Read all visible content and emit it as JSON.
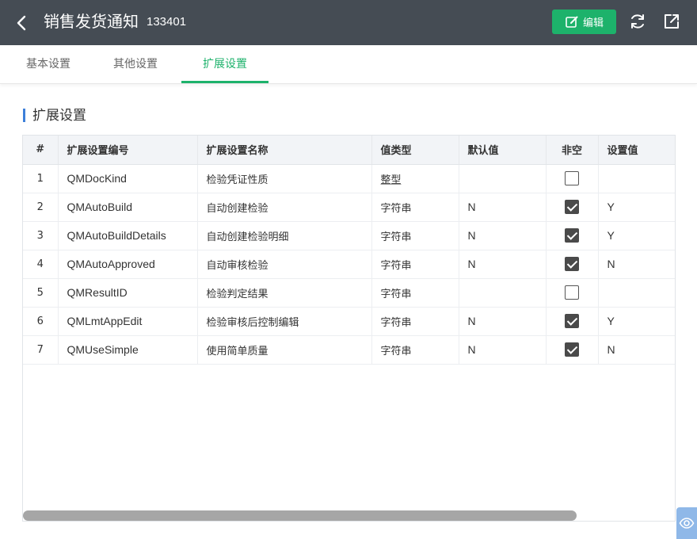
{
  "header": {
    "title": "销售发货通知",
    "doc_no": "133401",
    "edit_label": "编辑"
  },
  "tabs": [
    {
      "label": "基本设置",
      "active": false
    },
    {
      "label": "其他设置",
      "active": false
    },
    {
      "label": "扩展设置",
      "active": true
    }
  ],
  "section": {
    "title": "扩展设置"
  },
  "table": {
    "columns": [
      "#",
      "扩展设置编号",
      "扩展设置名称",
      "值类型",
      "默认值",
      "非空",
      "设置值"
    ],
    "rows": [
      {
        "num": "1",
        "code": "QMDocKind",
        "name": "检验凭证性质",
        "type": "整型",
        "default": "",
        "required": false,
        "value": ""
      },
      {
        "num": "2",
        "code": "QMAutoBuild",
        "name": "自动创建检验",
        "type": "字符串",
        "default": "N",
        "required": true,
        "value": "Y"
      },
      {
        "num": "3",
        "code": "QMAutoBuildDetails",
        "name": "自动创建检验明细",
        "type": "字符串",
        "default": "N",
        "required": true,
        "value": "Y"
      },
      {
        "num": "4",
        "code": "QMAutoApproved",
        "name": "自动审核检验",
        "type": "字符串",
        "default": "N",
        "required": true,
        "value": "N"
      },
      {
        "num": "5",
        "code": "QMResultID",
        "name": "检验判定结果",
        "type": "字符串",
        "default": "",
        "required": false,
        "value": ""
      },
      {
        "num": "6",
        "code": "QMLmtAppEdit",
        "name": "检验审核后控制编辑",
        "type": "字符串",
        "default": "N",
        "required": true,
        "value": "Y"
      },
      {
        "num": "7",
        "code": "QMUseSimple",
        "name": "使用简单质量",
        "type": "字符串",
        "default": "N",
        "required": true,
        "value": "N"
      }
    ]
  },
  "colors": {
    "header_bg": "#454c54",
    "accent_green": "#1db26b",
    "section_bar": "#3d7fd9"
  },
  "icons": [
    "back-arrow-icon",
    "edit-icon",
    "refresh-icon",
    "export-icon",
    "eye-icon"
  ]
}
